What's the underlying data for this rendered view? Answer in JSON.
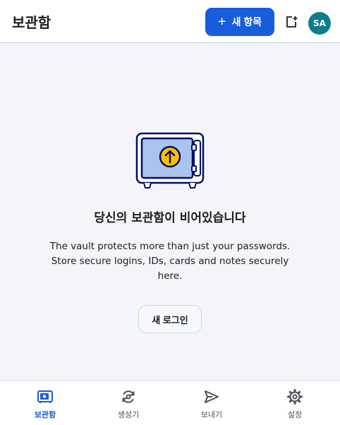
{
  "header": {
    "title": "보관함",
    "new_button_label": "새 항목",
    "avatar_initials": "SA"
  },
  "empty_state": {
    "title": "당신의 보관함이 비어있습니다",
    "description": "The vault protects more than just your passwords. Store secure logins, IDs, cards and notes securely here.",
    "new_login_label": "새 로그인"
  },
  "tabs": [
    {
      "label": "보관함",
      "icon": "vault-icon",
      "active": true
    },
    {
      "label": "생성기",
      "icon": "generator-icon",
      "active": false
    },
    {
      "label": "보내기",
      "icon": "send-icon",
      "active": false
    },
    {
      "label": "설정",
      "icon": "gear-icon",
      "active": false
    }
  ],
  "colors": {
    "accent": "#175ddc",
    "avatar": "#0d7d8c",
    "illustration_fill": "#aac3ef",
    "illustration_stroke": "#020f66",
    "illustration_badge": "#ffbf00"
  }
}
